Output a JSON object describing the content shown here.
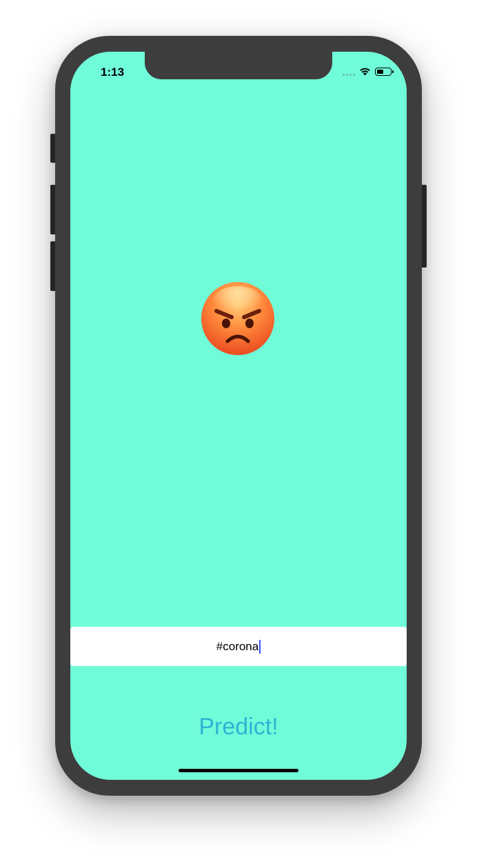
{
  "status_bar": {
    "time": "1:13",
    "signal_icon": "cellular-signal-icon",
    "wifi_icon": "wifi-icon",
    "battery_icon": "battery-icon",
    "battery_level": 0.5
  },
  "prediction": {
    "emoji_icon": "angry-face-emoji-icon"
  },
  "hashtag_input": {
    "value": "#corona"
  },
  "predict_button": {
    "label": "Predict!"
  },
  "colors": {
    "screen_background": "#71fcd9",
    "button_text": "#2eb2d3",
    "device_frame": "#3d3d3d",
    "caret": "#3d56ff"
  }
}
